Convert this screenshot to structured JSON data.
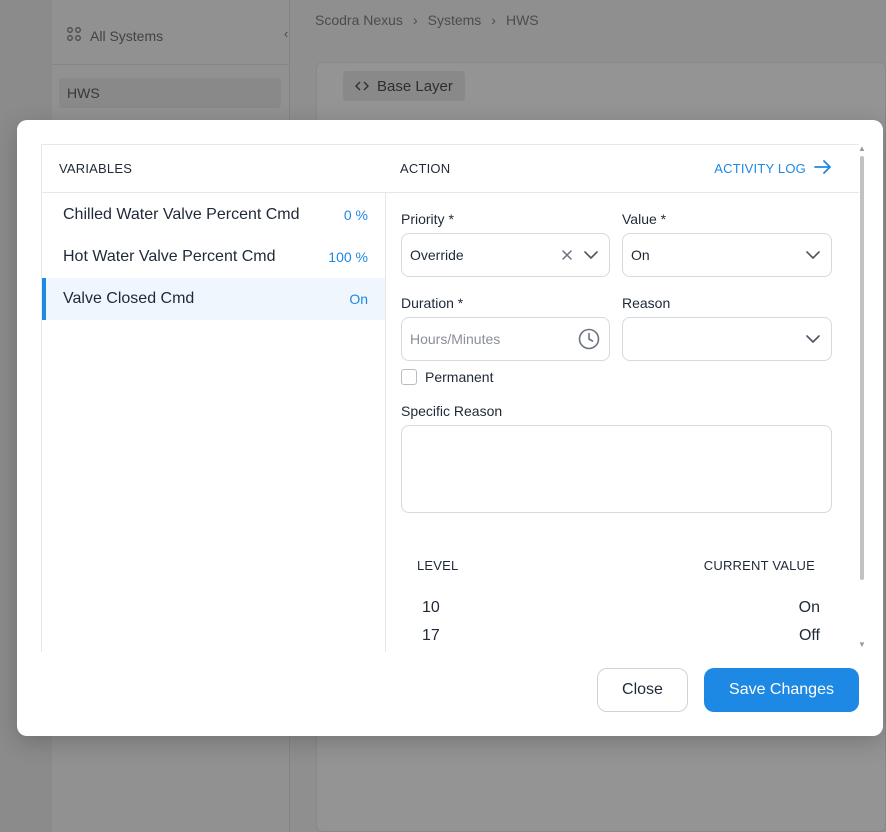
{
  "background": {
    "all_systems": "All Systems",
    "sidebar_item": "HWS",
    "breadcrumbs": [
      "Scodra Nexus",
      "Systems",
      "HWS"
    ],
    "base_layer": "Base Layer"
  },
  "modal": {
    "variables_header": "VARIABLES",
    "action_header": "ACTION",
    "activity_log": "ACTIVITY LOG",
    "variables": [
      {
        "name": "Chilled Water Valve Percent Cmd",
        "value": "0 %"
      },
      {
        "name": "Hot Water Valve Percent Cmd",
        "value": "100 %"
      },
      {
        "name": "Valve Closed Cmd",
        "value": "On",
        "selected": true
      }
    ],
    "form": {
      "priority_label": "Priority *",
      "priority_value": "Override",
      "value_label": "Value *",
      "value_value": "On",
      "duration_label": "Duration *",
      "duration_placeholder": "Hours/Minutes",
      "reason_label": "Reason",
      "reason_value": "",
      "permanent_label": "Permanent",
      "permanent_checked": false,
      "specific_reason_label": "Specific Reason"
    },
    "level_table": {
      "level_header": "LEVEL",
      "current_value_header": "CURRENT VALUE",
      "rows": [
        {
          "level": "10",
          "value": "On"
        },
        {
          "level": "17",
          "value": "Off"
        }
      ]
    },
    "close_label": "Close",
    "save_label": "Save Changes"
  },
  "colors": {
    "accent": "#1e88e5",
    "selected_row_bg": "#eff6fd",
    "border": "#d6d9de"
  }
}
